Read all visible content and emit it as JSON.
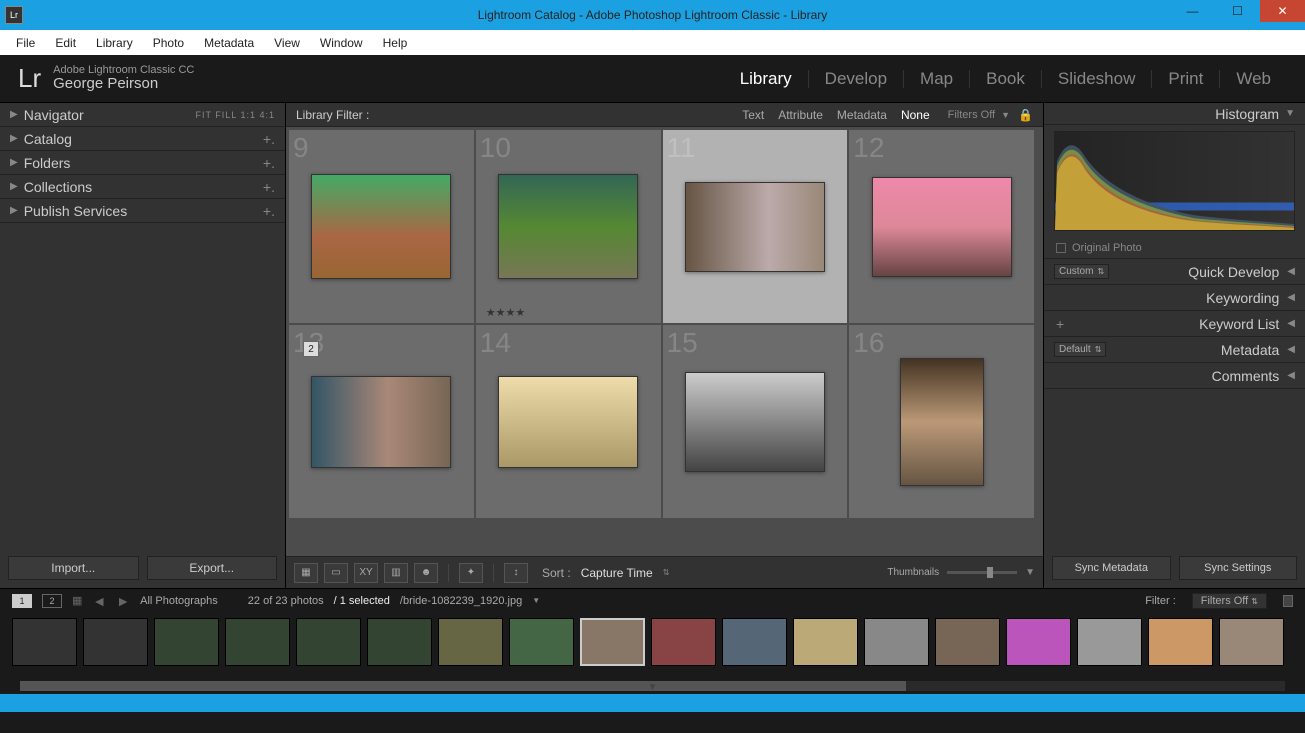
{
  "window": {
    "title": "Lightroom Catalog - Adobe Photoshop Lightroom Classic - Library",
    "badge": "Lr"
  },
  "menu": [
    "File",
    "Edit",
    "Library",
    "Photo",
    "Metadata",
    "View",
    "Window",
    "Help"
  ],
  "header": {
    "logo": "Lr",
    "product": "Adobe Lightroom Classic CC",
    "user": "George Peirson",
    "modules": [
      "Library",
      "Develop",
      "Map",
      "Book",
      "Slideshow",
      "Print",
      "Web"
    ],
    "active_module": "Library"
  },
  "left_panel": {
    "navigator": {
      "label": "Navigator",
      "zoom": "FIT   FILL   1:1   4:1"
    },
    "sections": [
      "Catalog",
      "Folders",
      "Collections",
      "Publish Services"
    ],
    "import": "Import...",
    "export": "Export..."
  },
  "filter_bar": {
    "label": "Library Filter :",
    "options": [
      "Text",
      "Attribute",
      "Metadata",
      "None"
    ],
    "active": "None",
    "filters_off": "Filters Off"
  },
  "grid": {
    "cells": [
      {
        "n": "9",
        "kind": "bridge"
      },
      {
        "n": "10",
        "kind": "deer",
        "stars": "★★★★"
      },
      {
        "n": "11",
        "kind": "bride",
        "selected": true
      },
      {
        "n": "12",
        "kind": "boat"
      },
      {
        "n": "13",
        "kind": "girl13",
        "stack": "2"
      },
      {
        "n": "14",
        "kind": "girl14"
      },
      {
        "n": "15",
        "kind": "bw"
      },
      {
        "n": "16",
        "kind": "girl16"
      }
    ]
  },
  "toolbar": {
    "sort_label": "Sort :",
    "sort_value": "Capture Time",
    "thumb_label": "Thumbnails"
  },
  "right_panel": {
    "histogram": "Histogram",
    "original": "Original Photo",
    "quick_develop": {
      "dropdown": "Custom",
      "label": "Quick Develop"
    },
    "keywording": "Keywording",
    "keyword_list": "Keyword List",
    "metadata": {
      "dropdown": "Default",
      "label": "Metadata"
    },
    "comments": "Comments",
    "sync_meta": "Sync Metadata",
    "sync_settings": "Sync Settings"
  },
  "info_bar": {
    "pages": [
      "1",
      "2"
    ],
    "source": "All Photographs",
    "count": "22 of 23 photos",
    "selected": "/ 1 selected",
    "filename": "/bride-1082239_1920.jpg",
    "filter_label": "Filter :",
    "filter_value": "Filters Off"
  },
  "filmstrip": {
    "count": 18,
    "selected_index": 8,
    "stars_index": 7
  }
}
